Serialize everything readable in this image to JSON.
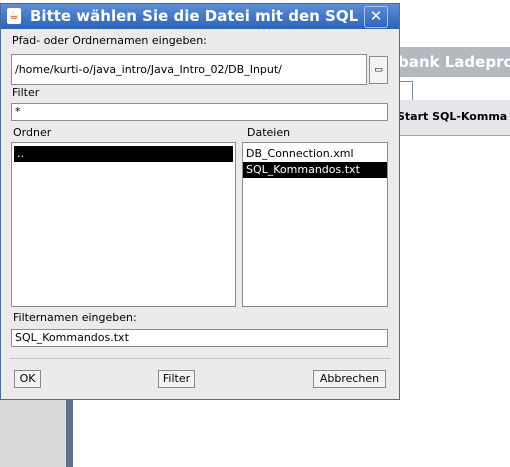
{
  "background": {
    "partial_title": "bank Ladepro",
    "partial_column_label": "Start SQL-Komma"
  },
  "dialog": {
    "title": "Bitte wählen Sie die Datei mit den SQL",
    "app_icon": "java-icon",
    "close_glyph": "✕",
    "path_label": "Pfad- oder Ordnernamen eingeben:",
    "path_value": "/home/kurti-o/java_intro/Java_Intro_02/DB_Input/",
    "browse_glyph": "▭",
    "filter_label": "Filter",
    "filter_value": "*",
    "folders_label": "Ordner",
    "folders": [
      ".."
    ],
    "files_label": "Dateien",
    "files": [
      "DB_Connection.xml",
      "SQL_Kommandos.txt"
    ],
    "selected_file": "SQL_Kommandos.txt",
    "filename_label": "Filternamen eingeben:",
    "filename_value": "SQL_Kommandos.txt",
    "ok_label": "OK",
    "filter_button_label": "Filter",
    "cancel_label": "Abbrechen"
  }
}
